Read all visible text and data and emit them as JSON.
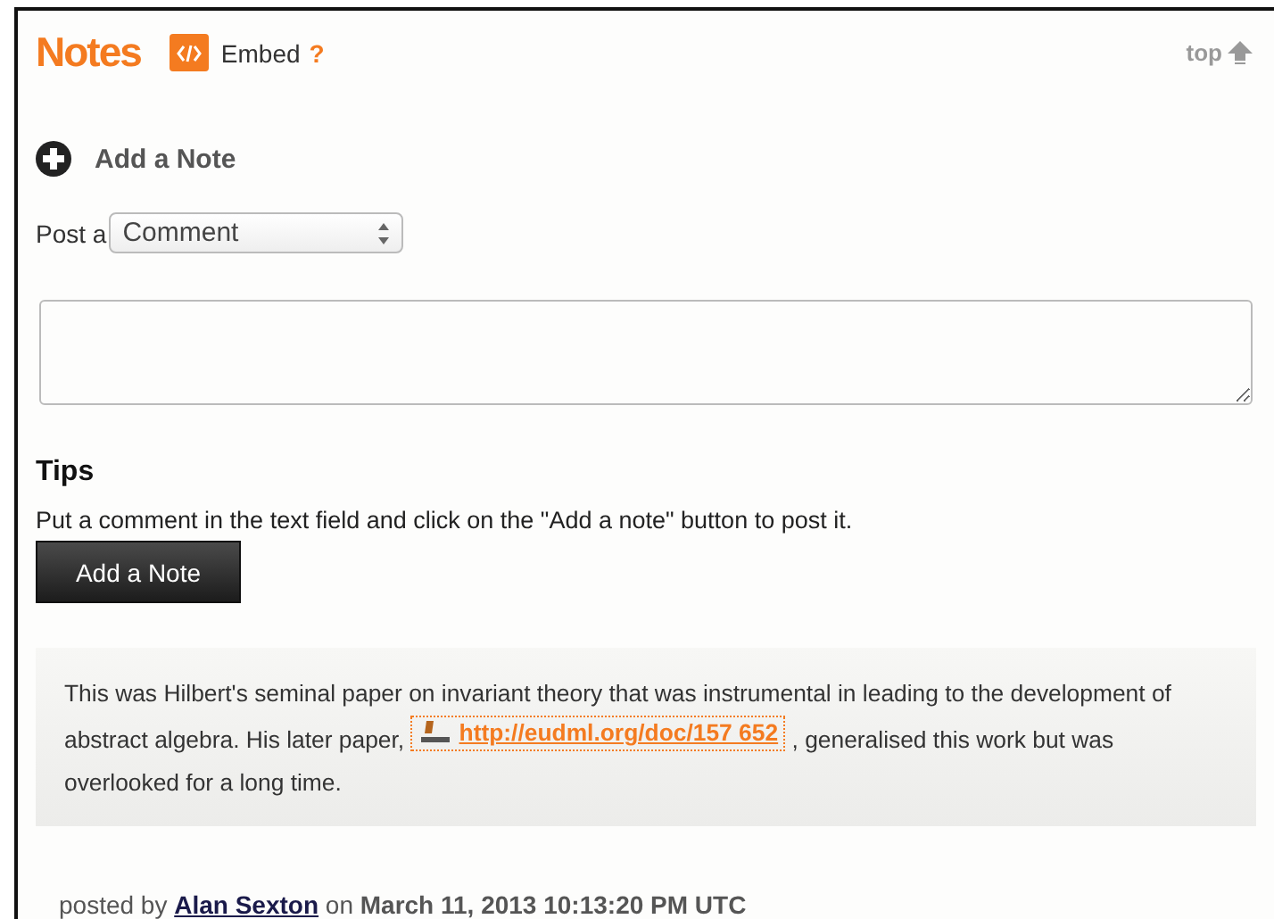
{
  "header": {
    "title": "Notes",
    "embed_label": "Embed",
    "help": "?",
    "top_link": "top"
  },
  "add_note": {
    "label": "Add a Note"
  },
  "post_type": {
    "label": "Post a",
    "value": "Comment"
  },
  "tips": {
    "heading": "Tips",
    "text": "Put a comment in the text field and click on the \"Add a note\" button to post it.",
    "button": "Add a Note"
  },
  "note": {
    "text_before": "This was Hilbert's seminal paper on invariant theory that was instrumental in leading to the development of abstract algebra. His later paper, ",
    "link": "http://eudml.org/doc/157 652",
    "text_after": " , generalised this work but was overlooked for a long time.",
    "posted_prefix": "posted by",
    "author": "Alan Sexton",
    "on": "on",
    "date": "March 11, 2013 10:13:20 PM UTC"
  }
}
